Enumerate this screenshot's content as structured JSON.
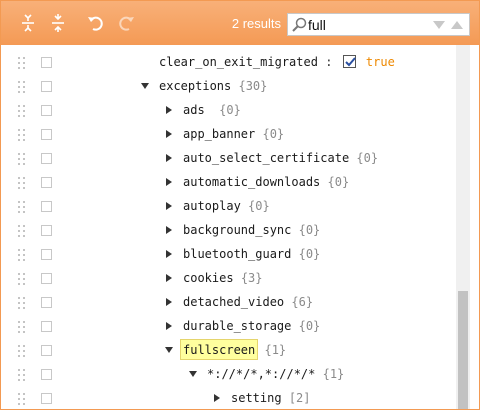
{
  "toolbar": {
    "expand_all_icon": "expand-all-icon",
    "collapse_all_icon": "collapse-all-icon",
    "undo_icon": "undo-icon",
    "redo_icon": "redo-icon",
    "results_text": "2 results",
    "search": {
      "value": "full",
      "placeholder": ""
    },
    "colors": {
      "toolbar_bg": "#f49a55",
      "border": "#f39a52"
    }
  },
  "tree": {
    "clear_on_exit": {
      "key": "clear_on_exit_migrated",
      "separator": ":",
      "checked": true,
      "value": "true"
    },
    "exceptions": {
      "key": "exceptions",
      "count": "{30}"
    },
    "children": [
      {
        "key": "ads",
        "count": "{0}"
      },
      {
        "key": "app_banner",
        "count": "{0}"
      },
      {
        "key": "auto_select_certificate",
        "count": "{0}"
      },
      {
        "key": "automatic_downloads",
        "count": "{0}"
      },
      {
        "key": "autoplay",
        "count": "{0}"
      },
      {
        "key": "background_sync",
        "count": "{0}"
      },
      {
        "key": "bluetooth_guard",
        "count": "{0}"
      },
      {
        "key": "cookies",
        "count": "{3}"
      },
      {
        "key": "detached_video",
        "count": "{6}"
      },
      {
        "key": "durable_storage",
        "count": "{0}"
      }
    ],
    "fullscreen": {
      "key": "fullscreen",
      "count": "{1}",
      "matched": true
    },
    "pattern": {
      "key": "*://*/*,*://*/*",
      "count": "{1}"
    },
    "setting": {
      "key": "setting",
      "count": "[2]"
    }
  }
}
